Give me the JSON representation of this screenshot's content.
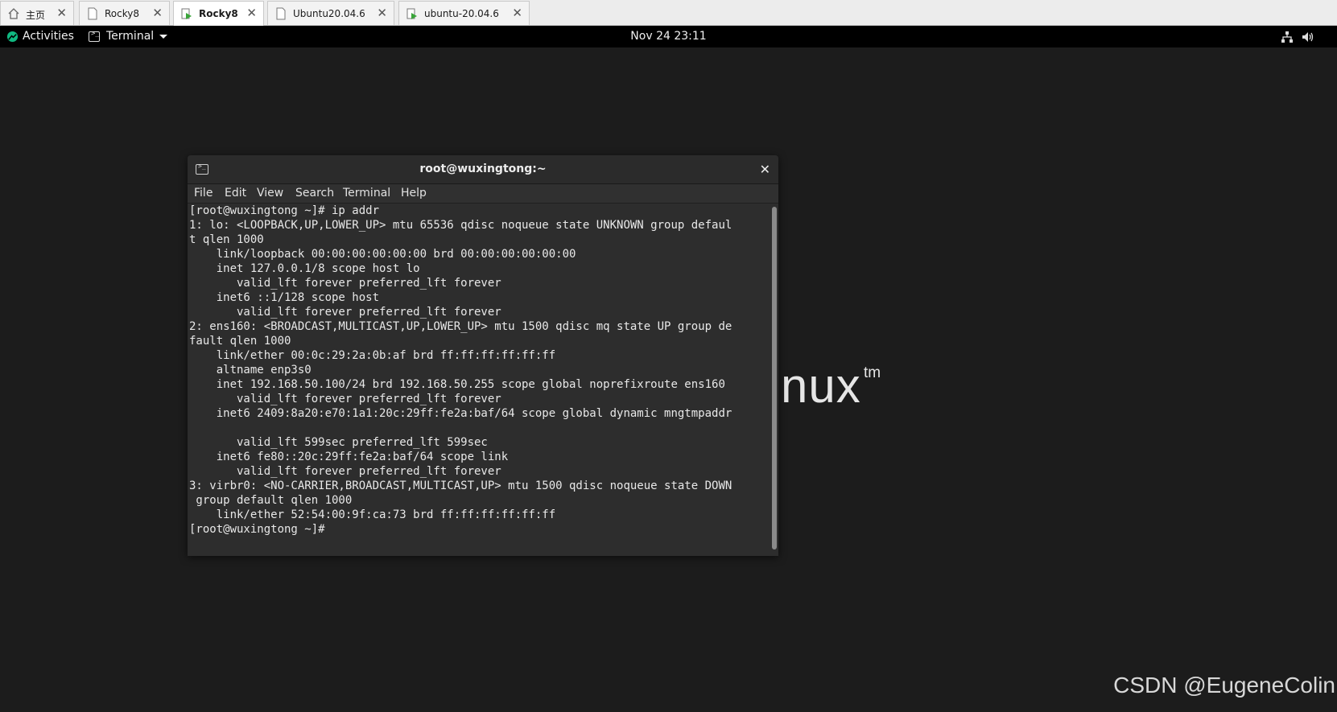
{
  "tabs": [
    {
      "label": "主页",
      "icon": "home-icon"
    },
    {
      "label": "Rocky8",
      "icon": "document-icon"
    },
    {
      "label": "Rocky8",
      "icon": "vm-running-icon",
      "active": true
    },
    {
      "label": "Ubuntu20.04.6",
      "icon": "document-icon"
    },
    {
      "label": "ubuntu-20.04.6",
      "icon": "vm-running-icon"
    }
  ],
  "topbar": {
    "activities": "Activities",
    "app_menu": "Terminal",
    "clock": "Nov 24  23:11"
  },
  "desktop": {
    "logo_text": "nux",
    "logo_tm": "tm",
    "watermark": "CSDN @EugeneColin"
  },
  "terminal": {
    "title": "root@wuxingtong:~",
    "menu": [
      "File",
      "Edit",
      "View",
      "Search",
      "Terminal",
      "Help"
    ],
    "lines": [
      "[root@wuxingtong ~]# ip addr",
      "1: lo: <LOOPBACK,UP,LOWER_UP> mtu 65536 qdisc noqueue state UNKNOWN group defaul",
      "t qlen 1000",
      "    link/loopback 00:00:00:00:00:00 brd 00:00:00:00:00:00",
      "    inet 127.0.0.1/8 scope host lo",
      "       valid_lft forever preferred_lft forever",
      "    inet6 ::1/128 scope host",
      "       valid_lft forever preferred_lft forever",
      "2: ens160: <BROADCAST,MULTICAST,UP,LOWER_UP> mtu 1500 qdisc mq state UP group de",
      "fault qlen 1000",
      "    link/ether 00:0c:29:2a:0b:af brd ff:ff:ff:ff:ff:ff",
      "    altname enp3s0",
      "    inet 192.168.50.100/24 brd 192.168.50.255 scope global noprefixroute ens160",
      "       valid_lft forever preferred_lft forever",
      "    inet6 2409:8a20:e70:1a1:20c:29ff:fe2a:baf/64 scope global dynamic mngtmpaddr",
      "",
      "       valid_lft 599sec preferred_lft 599sec",
      "    inet6 fe80::20c:29ff:fe2a:baf/64 scope link",
      "       valid_lft forever preferred_lft forever",
      "3: virbr0: <NO-CARRIER,BROADCAST,MULTICAST,UP> mtu 1500 qdisc noqueue state DOWN",
      " group default qlen 1000",
      "    link/ether 52:54:00:9f:ca:73 brd ff:ff:ff:ff:ff:ff",
      "[root@wuxingtong ~]# "
    ]
  }
}
